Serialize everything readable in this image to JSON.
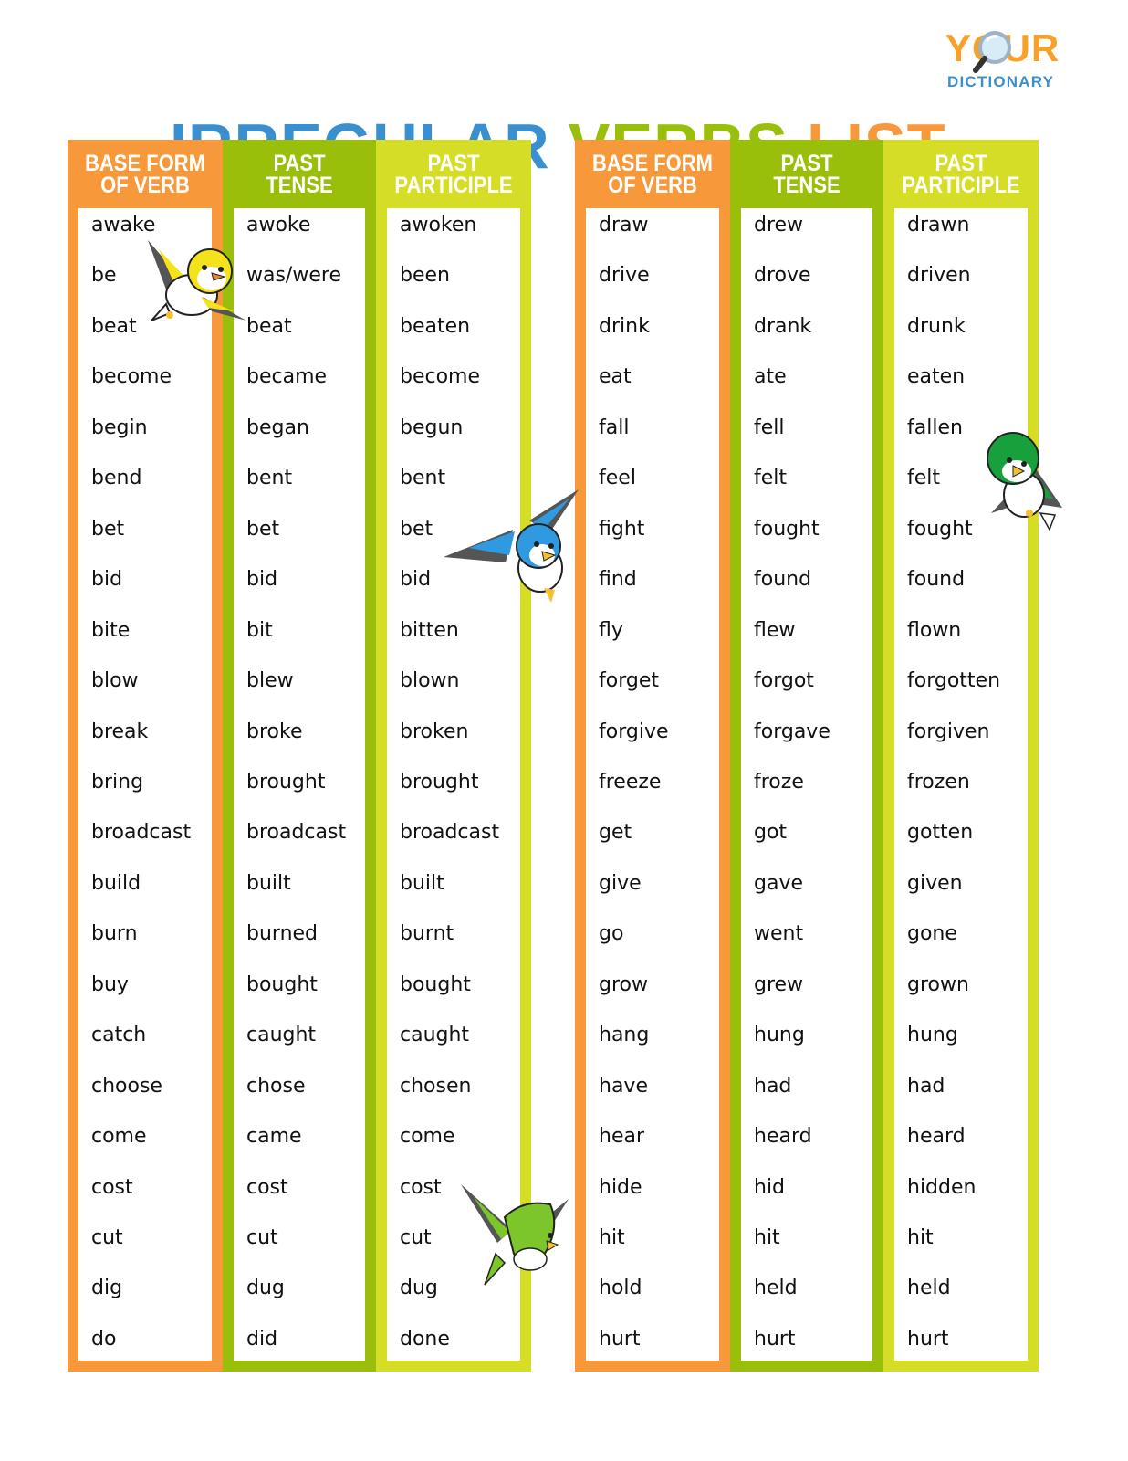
{
  "title": {
    "words": [
      {
        "text": "IRREGULAR",
        "color": "#3a8fcf"
      },
      {
        "text": "VERBS",
        "color": "#99bf0a"
      },
      {
        "text": "LIST",
        "color": "#f7993a"
      }
    ]
  },
  "logo": {
    "line1": "YOUR",
    "line2": "DICTIONARY",
    "icon": "magnifier-icon"
  },
  "colors": {
    "base": "#f7993a",
    "past": "#99bf0a",
    "participle": "#d6dd27"
  },
  "headers": {
    "base": "BASE FORM\nOF VERB",
    "past": "PAST\nTENSE",
    "participle": "PAST\nPARTICIPLE"
  },
  "tables": [
    {
      "rows": [
        {
          "base": "awake",
          "past": "awoke",
          "participle": "awoken"
        },
        {
          "base": "be",
          "past": "was/were",
          "participle": "been"
        },
        {
          "base": "beat",
          "past": "beat",
          "participle": "beaten"
        },
        {
          "base": "become",
          "past": "became",
          "participle": "become"
        },
        {
          "base": "begin",
          "past": "began",
          "participle": "begun"
        },
        {
          "base": "bend",
          "past": "bent",
          "participle": "bent"
        },
        {
          "base": "bet",
          "past": "bet",
          "participle": "bet"
        },
        {
          "base": "bid",
          "past": "bid",
          "participle": "bid"
        },
        {
          "base": "bite",
          "past": "bit",
          "participle": "bitten"
        },
        {
          "base": "blow",
          "past": "blew",
          "participle": "blown"
        },
        {
          "base": "break",
          "past": "broke",
          "participle": "broken"
        },
        {
          "base": "bring",
          "past": "brought",
          "participle": "brought"
        },
        {
          "base": "broadcast",
          "past": "broadcast",
          "participle": "broadcast"
        },
        {
          "base": "build",
          "past": "built",
          "participle": "built"
        },
        {
          "base": "burn",
          "past": "burned",
          "participle": "burnt"
        },
        {
          "base": "buy",
          "past": "bought",
          "participle": "bought"
        },
        {
          "base": "catch",
          "past": "caught",
          "participle": "caught"
        },
        {
          "base": "choose",
          "past": "chose",
          "participle": "chosen"
        },
        {
          "base": "come",
          "past": "came",
          "participle": "come"
        },
        {
          "base": "cost",
          "past": "cost",
          "participle": "cost"
        },
        {
          "base": "cut",
          "past": "cut",
          "participle": "cut"
        },
        {
          "base": "dig",
          "past": "dug",
          "participle": "dug"
        },
        {
          "base": "do",
          "past": "did",
          "participle": "done"
        }
      ]
    },
    {
      "rows": [
        {
          "base": "draw",
          "past": "drew",
          "participle": "drawn"
        },
        {
          "base": "drive",
          "past": "drove",
          "participle": "driven"
        },
        {
          "base": "drink",
          "past": "drank",
          "participle": "drunk"
        },
        {
          "base": "eat",
          "past": "ate",
          "participle": "eaten"
        },
        {
          "base": "fall",
          "past": "fell",
          "participle": "fallen"
        },
        {
          "base": "feel",
          "past": "felt",
          "participle": "felt"
        },
        {
          "base": "fight",
          "past": "fought",
          "participle": "fought"
        },
        {
          "base": "find",
          "past": "found",
          "participle": "found"
        },
        {
          "base": "fly",
          "past": "flew",
          "participle": "flown"
        },
        {
          "base": "forget",
          "past": "forgot",
          "participle": "forgotten"
        },
        {
          "base": "forgive",
          "past": "forgave",
          "participle": "forgiven"
        },
        {
          "base": "freeze",
          "past": "froze",
          "participle": "frozen"
        },
        {
          "base": "get",
          "past": "got",
          "participle": "gotten"
        },
        {
          "base": "give",
          "past": "gave",
          "participle": "given"
        },
        {
          "base": "go",
          "past": "went",
          "participle": "gone"
        },
        {
          "base": "grow",
          "past": "grew",
          "participle": "grown"
        },
        {
          "base": "hang",
          "past": "hung",
          "participle": "hung"
        },
        {
          "base": "have",
          "past": "had",
          "participle": "had"
        },
        {
          "base": "hear",
          "past": "heard",
          "participle": "heard"
        },
        {
          "base": "hide",
          "past": "hid",
          "participle": "hidden"
        },
        {
          "base": "hit",
          "past": "hit",
          "participle": "hit"
        },
        {
          "base": "hold",
          "past": "held",
          "participle": "held"
        },
        {
          "base": "hurt",
          "past": "hurt",
          "participle": "hurt"
        }
      ]
    }
  ],
  "decorations": [
    {
      "name": "yellow-bird-icon",
      "body": "#f4e21a",
      "wing": "#555555"
    },
    {
      "name": "blue-bird-icon",
      "body": "#2f9ae0",
      "wing": "#555555"
    },
    {
      "name": "green-bird-icon",
      "body": "#18a03c",
      "wing": "#555555"
    },
    {
      "name": "lime-bird-icon",
      "body": "#7cc52a",
      "wing": "#555555"
    }
  ]
}
